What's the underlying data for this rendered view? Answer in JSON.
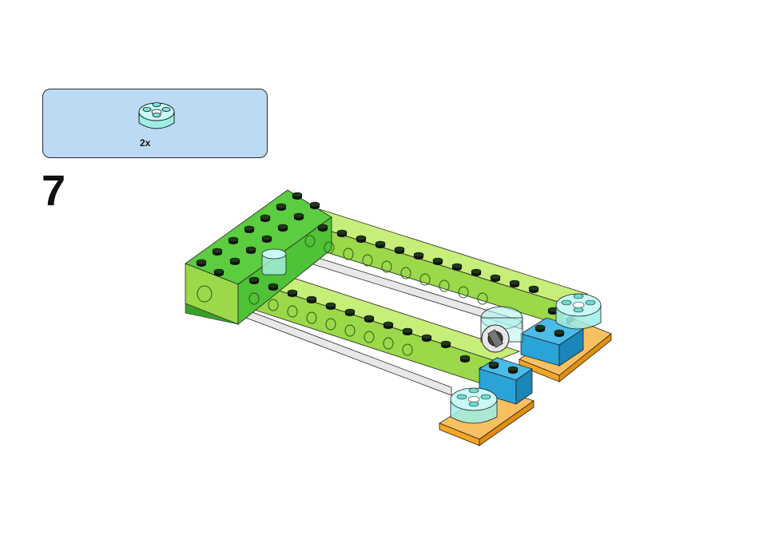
{
  "step": {
    "number": "7"
  },
  "parts_list": {
    "items": [
      {
        "icon": "transparent-round-brick-2x2-icon",
        "quantity": "2x",
        "color": "#aef3ee"
      }
    ]
  },
  "colors": {
    "lime": "#9bd84a",
    "bright_green": "#4fc238",
    "orange": "#f5a623",
    "azure": "#2aa3d6",
    "trans_cyan": "#aef3ee",
    "callout_bg": "#bcdaf4"
  }
}
